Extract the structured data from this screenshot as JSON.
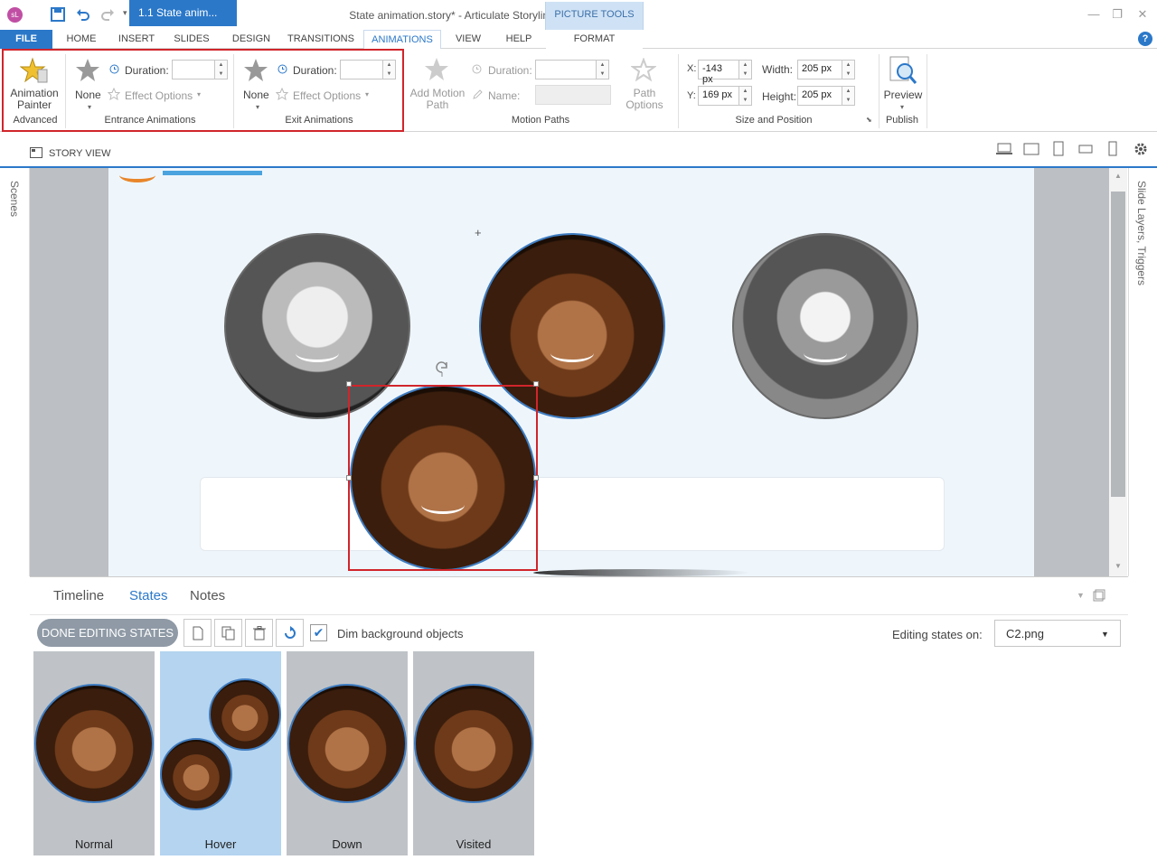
{
  "window": {
    "app_icon": "sL",
    "title": "State animation.story* -  Articulate Storyline"
  },
  "ribbon_tabs": [
    "FILE",
    "HOME",
    "INSERT",
    "SLIDES",
    "DESIGN",
    "TRANSITIONS",
    "ANIMATIONS",
    "VIEW",
    "HELP"
  ],
  "picture_tools": {
    "label": "PICTURE TOOLS",
    "tab": "FORMAT"
  },
  "advanced": {
    "painter_line1": "Animation",
    "painter_line2": "Painter",
    "group": "Advanced"
  },
  "entrance": {
    "none": "None",
    "duration": "Duration:",
    "effect": "Effect Options",
    "group": "Entrance Animations"
  },
  "exit": {
    "none": "None",
    "duration": "Duration:",
    "effect": "Effect Options",
    "group": "Exit Animations"
  },
  "motion": {
    "add_line1": "Add Motion",
    "add_line2": "Path",
    "duration": "Duration:",
    "name": "Name:",
    "path_line1": "Path",
    "path_line2": "Options",
    "group": "Motion Paths"
  },
  "size_pos": {
    "x_label": "X:",
    "x_value": "-143 px",
    "y_label": "Y:",
    "y_value": "169 px",
    "w_label": "Width:",
    "w_value": "205 px",
    "h_label": "Height:",
    "h_value": "205 px",
    "group": "Size and Position"
  },
  "publish": {
    "preview": "Preview",
    "group": "Publish"
  },
  "view_tabs": {
    "story_view": "STORY VIEW",
    "slide_tab": "1.1 State anim..."
  },
  "side_panels": {
    "scenes": "Scenes",
    "layers": "Slide Layers, Triggers"
  },
  "bottom_tabs": [
    "Timeline",
    "States",
    "Notes"
  ],
  "states_toolbar": {
    "done": "DONE EDITING STATES",
    "dim_label": "Dim background objects",
    "dim_checked": true,
    "editing_label": "Editing states on:",
    "editing_value": "C2.png"
  },
  "states": [
    "Normal",
    "Hover",
    "Down",
    "Visited"
  ],
  "colors": {
    "accent": "#2b78c9",
    "highlight": "#d0252b"
  }
}
